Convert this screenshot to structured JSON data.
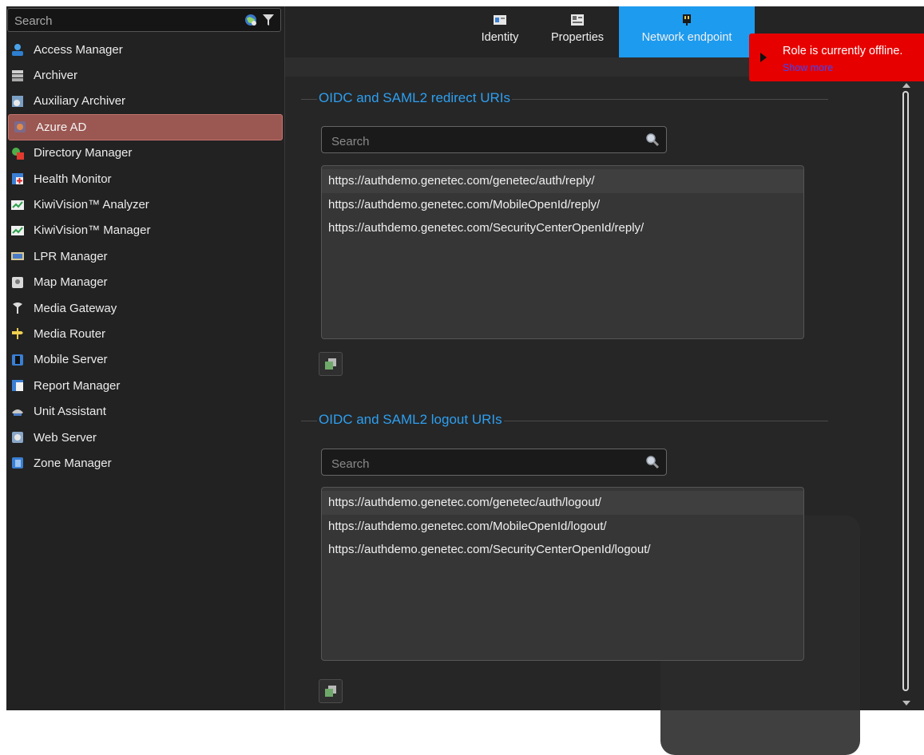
{
  "sidebar": {
    "search": {
      "placeholder": "Search"
    },
    "items": [
      {
        "label": "Access Manager",
        "icon": "access-manager-icon"
      },
      {
        "label": "Archiver",
        "icon": "archiver-icon"
      },
      {
        "label": "Auxiliary Archiver",
        "icon": "auxiliary-archiver-icon"
      },
      {
        "label": "Azure AD",
        "icon": "azure-ad-icon",
        "selected": true
      },
      {
        "label": "Directory Manager",
        "icon": "directory-manager-icon"
      },
      {
        "label": "Health Monitor",
        "icon": "health-monitor-icon"
      },
      {
        "label": "KiwiVision™ Analyzer",
        "icon": "kiwivision-analyzer-icon"
      },
      {
        "label": "KiwiVision™ Manager",
        "icon": "kiwivision-manager-icon"
      },
      {
        "label": "LPR Manager",
        "icon": "lpr-manager-icon"
      },
      {
        "label": "Map Manager",
        "icon": "map-manager-icon"
      },
      {
        "label": "Media Gateway",
        "icon": "media-gateway-icon"
      },
      {
        "label": "Media Router",
        "icon": "media-router-icon"
      },
      {
        "label": "Mobile Server",
        "icon": "mobile-server-icon"
      },
      {
        "label": "Report Manager",
        "icon": "report-manager-icon"
      },
      {
        "label": "Unit Assistant",
        "icon": "unit-assistant-icon"
      },
      {
        "label": "Web Server",
        "icon": "web-server-icon"
      },
      {
        "label": "Zone Manager",
        "icon": "zone-manager-icon"
      }
    ]
  },
  "tabs": [
    {
      "label": "Identity",
      "icon": "identity-icon"
    },
    {
      "label": "Properties",
      "icon": "properties-icon"
    },
    {
      "label": "Network endpoint",
      "icon": "network-endpoint-icon",
      "active": true
    }
  ],
  "alert": {
    "message": "Role is currently offline.",
    "link": "Show more"
  },
  "redirect": {
    "title": "OIDC and SAML2 redirect URIs",
    "search_placeholder": "Search",
    "uris": [
      "https://authdemo.genetec.com/genetec/auth/reply/",
      "https://authdemo.genetec.com/MobileOpenId/reply/",
      "https://authdemo.genetec.com/SecurityCenterOpenId/reply/"
    ]
  },
  "logout": {
    "title": "OIDC and SAML2 logout URIs",
    "search_placeholder": "Search",
    "uris": [
      "https://authdemo.genetec.com/genetec/auth/logout/",
      "https://authdemo.genetec.com/MobileOpenId/logout/",
      "https://authdemo.genetec.com/SecurityCenterOpenId/logout/"
    ]
  },
  "colors": {
    "accent": "#1d9bef",
    "section_title": "#2e9ff0",
    "selected_row": "#9b5752",
    "alert_bg": "#e60000",
    "alert_link": "#3b48ff"
  }
}
